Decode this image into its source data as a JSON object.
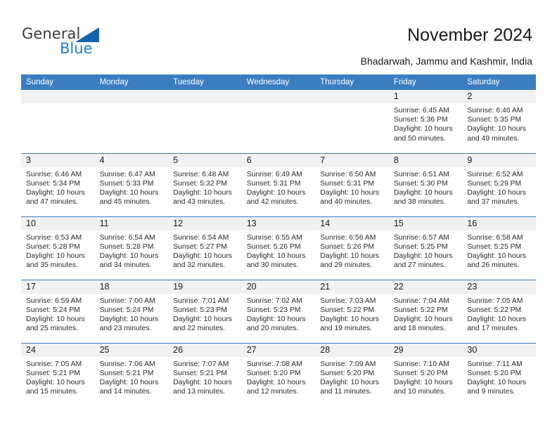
{
  "brand": {
    "name_top": "General",
    "name_bottom": "Blue"
  },
  "header": {
    "title": "November 2024",
    "subtitle": "Bhadarwah, Jammu and Kashmir, India"
  },
  "colors": {
    "header_blue": "#3b7ec0",
    "logo_blue": "#1b7fd4",
    "logo_triangle": "#1064ad",
    "daynum_band": "#f1f1f1"
  },
  "calendar": {
    "weekday_headers": [
      "Sunday",
      "Monday",
      "Tuesday",
      "Wednesday",
      "Thursday",
      "Friday",
      "Saturday"
    ],
    "weeks": [
      [
        {
          "day": "",
          "sunrise": "",
          "sunset": "",
          "daylight": ""
        },
        {
          "day": "",
          "sunrise": "",
          "sunset": "",
          "daylight": ""
        },
        {
          "day": "",
          "sunrise": "",
          "sunset": "",
          "daylight": ""
        },
        {
          "day": "",
          "sunrise": "",
          "sunset": "",
          "daylight": ""
        },
        {
          "day": "",
          "sunrise": "",
          "sunset": "",
          "daylight": ""
        },
        {
          "day": "1",
          "sunrise": "Sunrise: 6:45 AM",
          "sunset": "Sunset: 5:36 PM",
          "daylight": "Daylight: 10 hours and 50 minutes."
        },
        {
          "day": "2",
          "sunrise": "Sunrise: 6:46 AM",
          "sunset": "Sunset: 5:35 PM",
          "daylight": "Daylight: 10 hours and 49 minutes."
        }
      ],
      [
        {
          "day": "3",
          "sunrise": "Sunrise: 6:46 AM",
          "sunset": "Sunset: 5:34 PM",
          "daylight": "Daylight: 10 hours and 47 minutes."
        },
        {
          "day": "4",
          "sunrise": "Sunrise: 6:47 AM",
          "sunset": "Sunset: 5:33 PM",
          "daylight": "Daylight: 10 hours and 45 minutes."
        },
        {
          "day": "5",
          "sunrise": "Sunrise: 6:48 AM",
          "sunset": "Sunset: 5:32 PM",
          "daylight": "Daylight: 10 hours and 43 minutes."
        },
        {
          "day": "6",
          "sunrise": "Sunrise: 6:49 AM",
          "sunset": "Sunset: 5:31 PM",
          "daylight": "Daylight: 10 hours and 42 minutes."
        },
        {
          "day": "7",
          "sunrise": "Sunrise: 6:50 AM",
          "sunset": "Sunset: 5:31 PM",
          "daylight": "Daylight: 10 hours and 40 minutes."
        },
        {
          "day": "8",
          "sunrise": "Sunrise: 6:51 AM",
          "sunset": "Sunset: 5:30 PM",
          "daylight": "Daylight: 10 hours and 38 minutes."
        },
        {
          "day": "9",
          "sunrise": "Sunrise: 6:52 AM",
          "sunset": "Sunset: 5:29 PM",
          "daylight": "Daylight: 10 hours and 37 minutes."
        }
      ],
      [
        {
          "day": "10",
          "sunrise": "Sunrise: 6:53 AM",
          "sunset": "Sunset: 5:28 PM",
          "daylight": "Daylight: 10 hours and 35 minutes."
        },
        {
          "day": "11",
          "sunrise": "Sunrise: 6:54 AM",
          "sunset": "Sunset: 5:28 PM",
          "daylight": "Daylight: 10 hours and 34 minutes."
        },
        {
          "day": "12",
          "sunrise": "Sunrise: 6:54 AM",
          "sunset": "Sunset: 5:27 PM",
          "daylight": "Daylight: 10 hours and 32 minutes."
        },
        {
          "day": "13",
          "sunrise": "Sunrise: 6:55 AM",
          "sunset": "Sunset: 5:26 PM",
          "daylight": "Daylight: 10 hours and 30 minutes."
        },
        {
          "day": "14",
          "sunrise": "Sunrise: 6:56 AM",
          "sunset": "Sunset: 5:26 PM",
          "daylight": "Daylight: 10 hours and 29 minutes."
        },
        {
          "day": "15",
          "sunrise": "Sunrise: 6:57 AM",
          "sunset": "Sunset: 5:25 PM",
          "daylight": "Daylight: 10 hours and 27 minutes."
        },
        {
          "day": "16",
          "sunrise": "Sunrise: 6:58 AM",
          "sunset": "Sunset: 5:25 PM",
          "daylight": "Daylight: 10 hours and 26 minutes."
        }
      ],
      [
        {
          "day": "17",
          "sunrise": "Sunrise: 6:59 AM",
          "sunset": "Sunset: 5:24 PM",
          "daylight": "Daylight: 10 hours and 25 minutes."
        },
        {
          "day": "18",
          "sunrise": "Sunrise: 7:00 AM",
          "sunset": "Sunset: 5:24 PM",
          "daylight": "Daylight: 10 hours and 23 minutes."
        },
        {
          "day": "19",
          "sunrise": "Sunrise: 7:01 AM",
          "sunset": "Sunset: 5:23 PM",
          "daylight": "Daylight: 10 hours and 22 minutes."
        },
        {
          "day": "20",
          "sunrise": "Sunrise: 7:02 AM",
          "sunset": "Sunset: 5:23 PM",
          "daylight": "Daylight: 10 hours and 20 minutes."
        },
        {
          "day": "21",
          "sunrise": "Sunrise: 7:03 AM",
          "sunset": "Sunset: 5:22 PM",
          "daylight": "Daylight: 10 hours and 19 minutes."
        },
        {
          "day": "22",
          "sunrise": "Sunrise: 7:04 AM",
          "sunset": "Sunset: 5:22 PM",
          "daylight": "Daylight: 10 hours and 18 minutes."
        },
        {
          "day": "23",
          "sunrise": "Sunrise: 7:05 AM",
          "sunset": "Sunset: 5:22 PM",
          "daylight": "Daylight: 10 hours and 17 minutes."
        }
      ],
      [
        {
          "day": "24",
          "sunrise": "Sunrise: 7:05 AM",
          "sunset": "Sunset: 5:21 PM",
          "daylight": "Daylight: 10 hours and 15 minutes."
        },
        {
          "day": "25",
          "sunrise": "Sunrise: 7:06 AM",
          "sunset": "Sunset: 5:21 PM",
          "daylight": "Daylight: 10 hours and 14 minutes."
        },
        {
          "day": "26",
          "sunrise": "Sunrise: 7:07 AM",
          "sunset": "Sunset: 5:21 PM",
          "daylight": "Daylight: 10 hours and 13 minutes."
        },
        {
          "day": "27",
          "sunrise": "Sunrise: 7:08 AM",
          "sunset": "Sunset: 5:20 PM",
          "daylight": "Daylight: 10 hours and 12 minutes."
        },
        {
          "day": "28",
          "sunrise": "Sunrise: 7:09 AM",
          "sunset": "Sunset: 5:20 PM",
          "daylight": "Daylight: 10 hours and 11 minutes."
        },
        {
          "day": "29",
          "sunrise": "Sunrise: 7:10 AM",
          "sunset": "Sunset: 5:20 PM",
          "daylight": "Daylight: 10 hours and 10 minutes."
        },
        {
          "day": "30",
          "sunrise": "Sunrise: 7:11 AM",
          "sunset": "Sunset: 5:20 PM",
          "daylight": "Daylight: 10 hours and 9 minutes."
        }
      ]
    ]
  }
}
